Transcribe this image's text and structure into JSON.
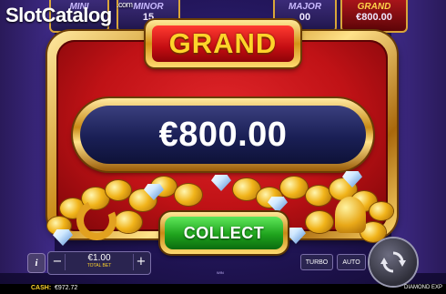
{
  "logo": {
    "brand": "SlotCatalog",
    "tld": ".com"
  },
  "jackpots": {
    "mini": {
      "label": "MINI",
      "value": ""
    },
    "minor": {
      "label": "MINOR",
      "value": "15"
    },
    "major": {
      "label": "MAJOR",
      "value": "00"
    },
    "grand": {
      "label": "GRAND",
      "value": "€800.00"
    }
  },
  "popup": {
    "title": "GRAND",
    "amount": "€800.00",
    "collect_label": "COLLECT"
  },
  "controls": {
    "info_label": "i",
    "bet_minus": "−",
    "bet_plus": "+",
    "bet_value": "€1.00",
    "bet_label": "TOTAL BET",
    "turbo_label": "TURBO",
    "auto_label": "AUTO",
    "win_indicator": "WIN"
  },
  "status_bar": {
    "cash_label": "CASH:",
    "cash_value": "€972.72",
    "game_name": "DIAMOND EXP"
  },
  "colors": {
    "gold": "#d9a63a",
    "panel_red": "#c01216",
    "amount_navy": "#1a1f55",
    "collect_green": "#1fa31d",
    "grand_text": "#ffd42a"
  },
  "icons": {
    "spin": "spin-arrows-icon",
    "info": "info-icon"
  }
}
